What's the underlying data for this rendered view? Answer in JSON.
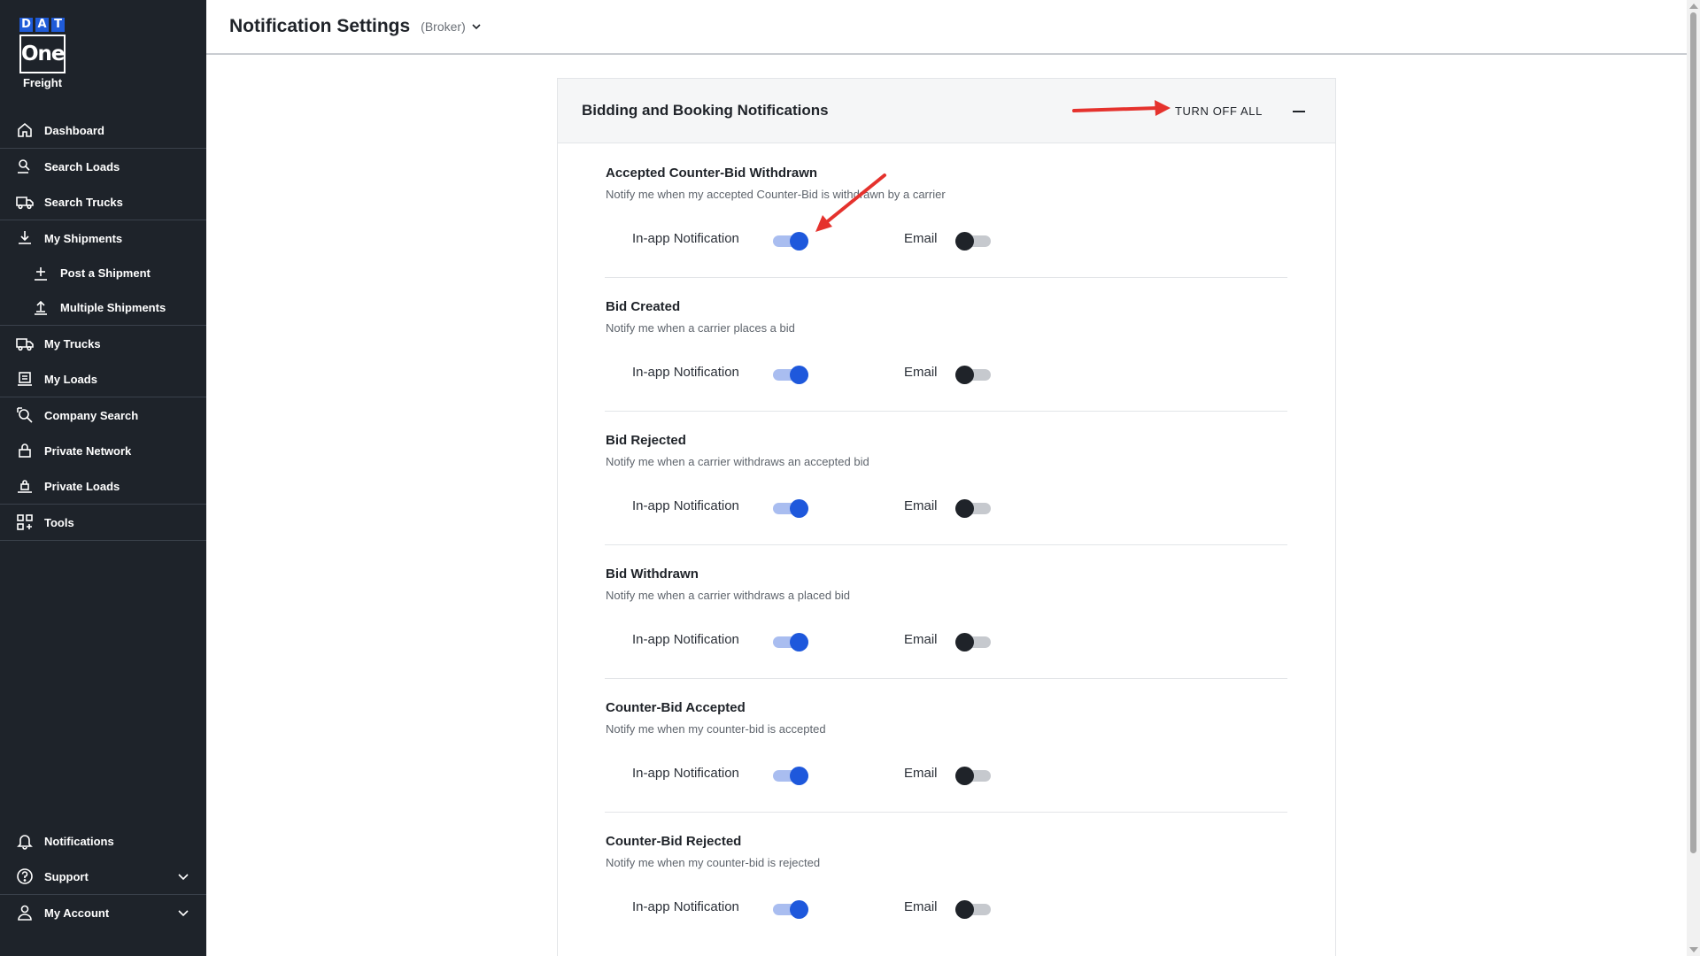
{
  "brand": {
    "logo_letters": [
      "D",
      "A",
      "T"
    ],
    "logo_one": "One",
    "logo_freight": "Freight",
    "accent_color": "#1f5bd8"
  },
  "sidebar": {
    "items": [
      {
        "label": "Dashboard",
        "icon": "home-icon"
      },
      {
        "label": "Search Loads",
        "icon": "search-loads-icon"
      },
      {
        "label": "Search Trucks",
        "icon": "truck-icon"
      },
      {
        "label": "My Shipments",
        "icon": "download-icon"
      },
      {
        "label": "Post a Shipment",
        "icon": "post-icon"
      },
      {
        "label": "Multiple Shipments",
        "icon": "upload-icon"
      },
      {
        "label": "My Trucks",
        "icon": "truck-icon"
      },
      {
        "label": "My Loads",
        "icon": "loads-icon"
      },
      {
        "label": "Company Search",
        "icon": "company-search-icon"
      },
      {
        "label": "Private Network",
        "icon": "lock-icon"
      },
      {
        "label": "Private Loads",
        "icon": "private-loads-icon"
      },
      {
        "label": "Tools",
        "icon": "grid-icon"
      }
    ],
    "bottom": [
      {
        "label": "Notifications",
        "icon": "bell-icon"
      },
      {
        "label": "Support",
        "icon": "question-icon"
      },
      {
        "label": "My Account",
        "icon": "user-icon"
      }
    ]
  },
  "header": {
    "title": "Notification Settings",
    "role": "(Broker)"
  },
  "card": {
    "title": "Bidding and Booking Notifications",
    "turn_off_all": "TURN OFF ALL",
    "in_app_label": "In-app Notification",
    "email_label": "Email",
    "sections": [
      {
        "title": "Accepted Counter-Bid Withdrawn",
        "desc": "Notify me when my accepted Counter-Bid is withdrawn by a carrier",
        "in_app": true,
        "email": false
      },
      {
        "title": "Bid Created",
        "desc": "Notify me when a carrier places a bid",
        "in_app": true,
        "email": false
      },
      {
        "title": "Bid Rejected",
        "desc": "Notify me when a carrier withdraws an accepted bid",
        "in_app": true,
        "email": false
      },
      {
        "title": "Bid Withdrawn",
        "desc": "Notify me when a carrier withdraws a placed bid",
        "in_app": true,
        "email": false
      },
      {
        "title": "Counter-Bid Accepted",
        "desc": "Notify me when my counter-bid is accepted",
        "in_app": true,
        "email": false
      },
      {
        "title": "Counter-Bid Rejected",
        "desc": "Notify me when my counter-bid is rejected",
        "in_app": true,
        "email": false
      }
    ]
  },
  "colors": {
    "sidebar_bg": "#1e232a",
    "toggle_on": "#1e58dc",
    "toggle_off": "#1f2329",
    "annotation": "#e5322d"
  }
}
